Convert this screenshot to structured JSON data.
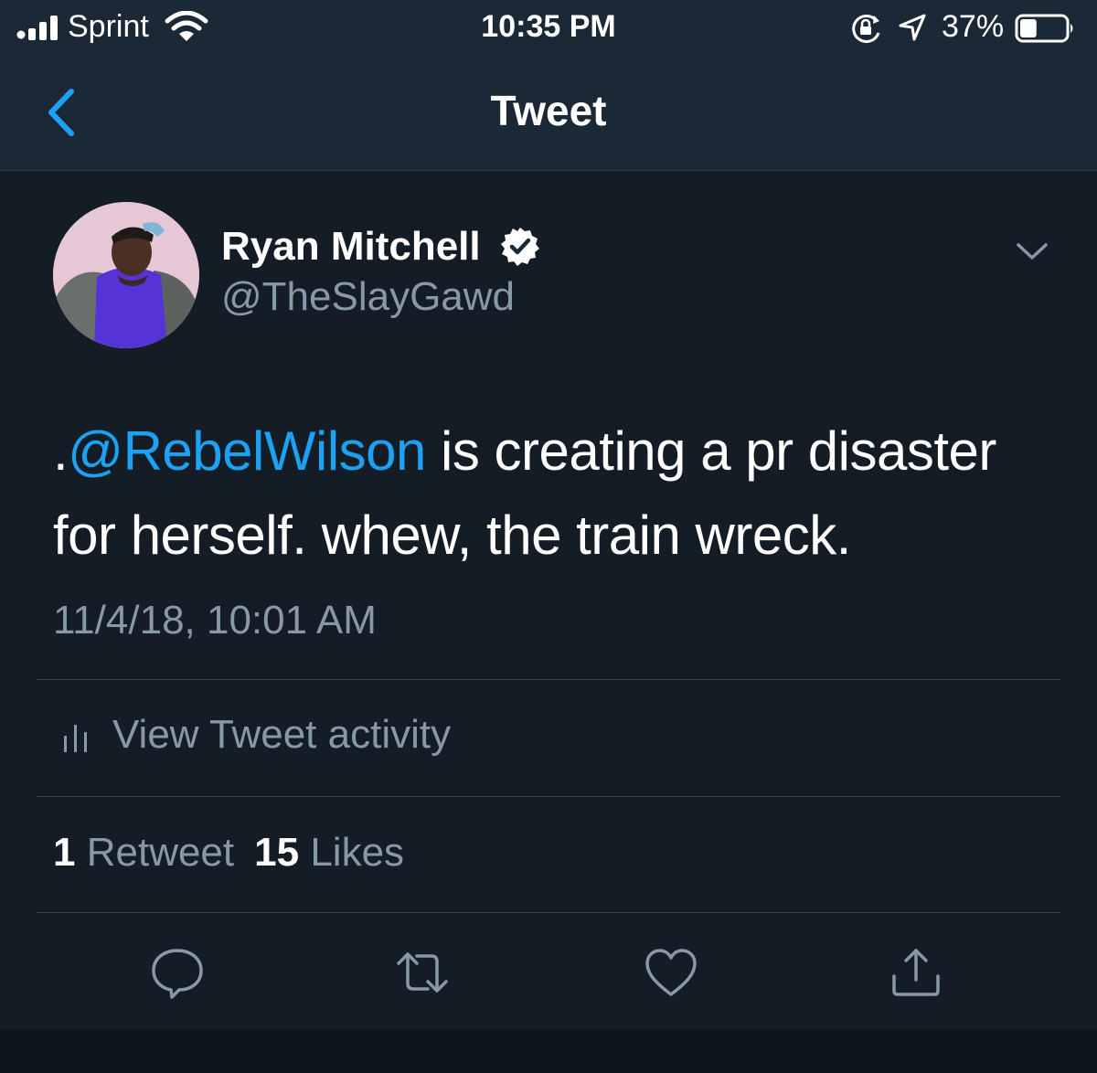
{
  "status_bar": {
    "carrier": "Sprint",
    "time": "10:35 PM",
    "battery_percent": "37%",
    "battery_level": 0.37,
    "icons": [
      "signal-icon",
      "wifi-icon",
      "rotation-lock-icon",
      "location-icon",
      "battery-icon"
    ]
  },
  "nav": {
    "title": "Tweet",
    "back_icon": "chevron-left-icon"
  },
  "tweet": {
    "author": {
      "display_name": "Ryan Mitchell",
      "handle": "@TheSlayGawd",
      "verified": true
    },
    "text": {
      "prefix": ".",
      "mention": "@RebelWilson",
      "body": " is creating a pr disaster for herself. whew, the train wreck."
    },
    "timestamp": "11/4/18, 10:01 AM",
    "activity_label": "View Tweet activity",
    "stats": {
      "retweets_count": "1",
      "retweets_label": "Retweet",
      "likes_count": "15",
      "likes_label": "Likes"
    },
    "actions": [
      "reply-icon",
      "retweet-icon",
      "like-icon",
      "share-icon"
    ]
  },
  "colors": {
    "background": "#141d26",
    "header": "#1b2836",
    "accent": "#1da1f2",
    "muted": "#8899a6",
    "divider": "#38444d"
  }
}
